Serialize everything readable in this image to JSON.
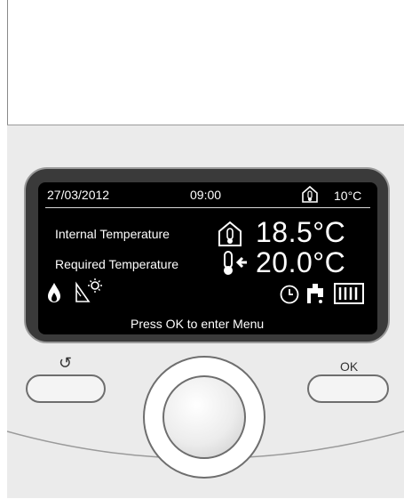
{
  "status_bar": {
    "date": "27/03/2012",
    "time": "09:00",
    "outdoor_temp": "10°C"
  },
  "readings": [
    {
      "label": "Internal Temperature",
      "value": "18.5°C"
    },
    {
      "label": "Required Temperature",
      "value": "20.0°C"
    }
  ],
  "footer_hint": "Press OK to enter Menu",
  "buttons": {
    "back_symbol": "↺",
    "ok_label": "OK"
  },
  "icons": {
    "status": [
      "home-thermometer-icon"
    ],
    "readings": [
      "home-thermometer-icon",
      "thermometer-arrow-icon"
    ],
    "modes": [
      "flame-icon",
      "solar-panel-icon",
      "clock-icon",
      "tap-icon",
      "radiator-icon"
    ]
  }
}
